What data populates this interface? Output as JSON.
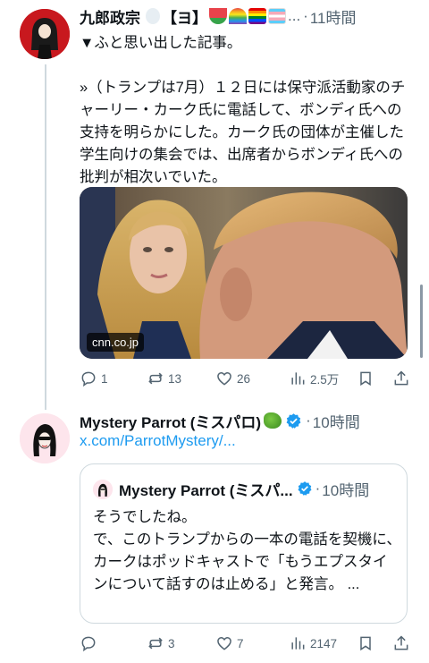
{
  "post1": {
    "author": "九郎政宗",
    "badge": "【ヨ】",
    "ellipsis": "...",
    "time_sep": "·",
    "time": "11時間",
    "text": "▼ふと思い出した記事。\n\n»（トランプは7月）１２日には保守派活動家のチャーリー・カーク氏に電話して、ボンディ氏への支持を明らかにした。カーク氏の団体が主催した学生向けの集会では、出席者からボンディ氏への批判が相次いでいた。",
    "media_source": "cnn.co.jp",
    "actions": {
      "reply": "1",
      "repost": "13",
      "like": "26",
      "views": "2.5万"
    }
  },
  "post2": {
    "author": "Mystery Parrot (ミスパロ)",
    "time_sep": "·",
    "time": "10時間",
    "link": "x.com/ParrotMystery/...",
    "quote": {
      "author": "Mystery Parrot (ミスパ...",
      "time_sep": "·",
      "time": "10時間",
      "text": "そうでしたね。\nで、このトランプからの一本の電話を契機に、カークはポッドキャストで「もうエプスタインについて話すのは止める」と発言。 ..."
    },
    "actions": {
      "reply": "",
      "repost": "3",
      "like": "7",
      "views": "2147"
    }
  },
  "icons": [
    "reply-icon",
    "repost-icon",
    "like-icon",
    "views-icon",
    "bookmark-icon",
    "share-icon",
    "verified-badge-icon",
    "parrot-emoji",
    "dove-emoji",
    "watermelon-emoji",
    "rainbow-emoji",
    "rainbow-flag-emoji",
    "trans-flag-emoji"
  ],
  "colors": {
    "accent": "#1d9bf0",
    "muted": "#536471",
    "border": "#cfd9de"
  }
}
